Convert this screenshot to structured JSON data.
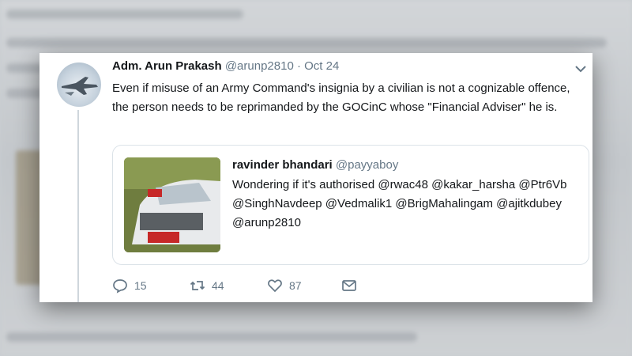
{
  "tweet": {
    "author_name": "Adm. Arun Prakash",
    "author_handle": "@arunp2810",
    "separator": "·",
    "date": "Oct 24",
    "text": "Even if misuse of an Army Command's insignia by a civilian is not a cognizable offence, the person needs to be reprimanded by the GOCinC whose \"Financial Adviser\" he is."
  },
  "quoted": {
    "author_name": "ravinder bhandari",
    "author_handle": "@payyaboy",
    "text": "Wondering if it's authorised @rwac48 @kakar_harsha @Ptr6Vb @SinghNavdeep @Vedmalik1 @BrigMahalingam @ajitkdubey @arunp2810"
  },
  "actions": {
    "reply_count": "15",
    "retweet_count": "44",
    "like_count": "87"
  },
  "icons": {
    "more": "chevron-down-icon",
    "reply": "reply-icon",
    "retweet": "retweet-icon",
    "like": "heart-icon",
    "message": "envelope-icon"
  },
  "colors": {
    "name": "#14171a",
    "secondary": "#657786",
    "border": "#dbe2e8"
  }
}
